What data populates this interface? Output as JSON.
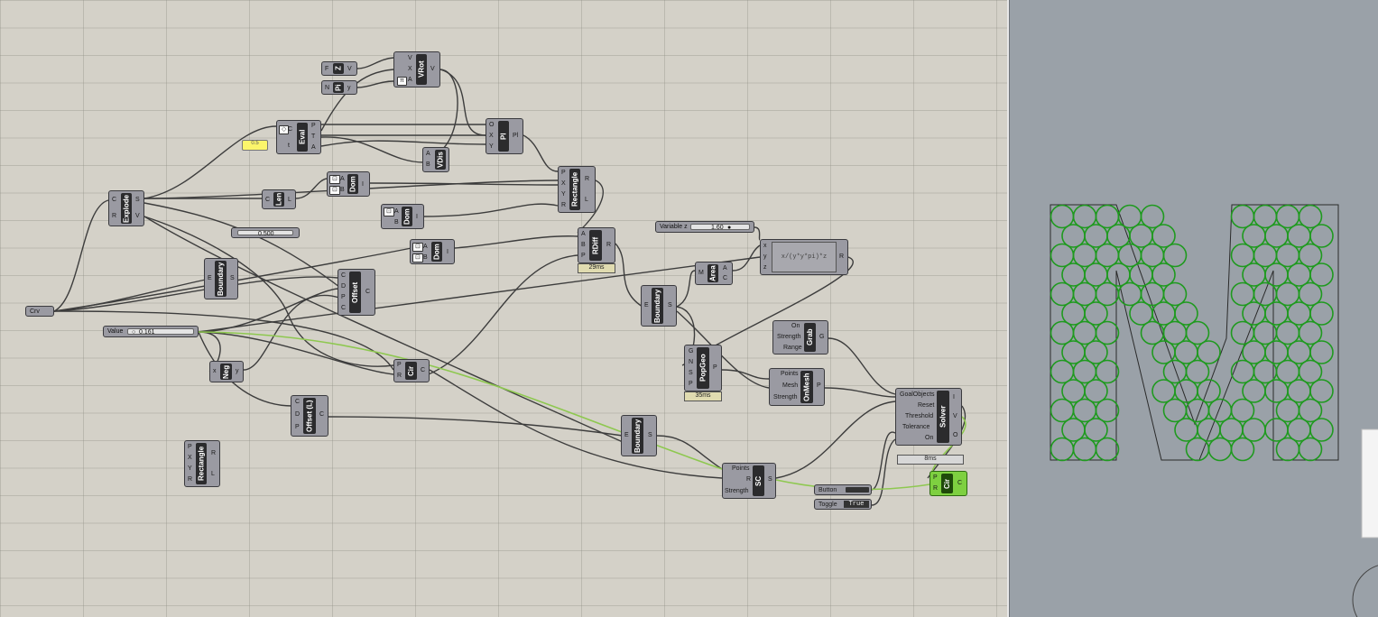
{
  "canvas": {
    "components": {
      "z": {
        "label": "Z",
        "inputs": [
          "F"
        ],
        "outputs": [
          "V"
        ]
      },
      "pi": {
        "label": "Pi",
        "inputs": [
          "N"
        ],
        "outputs": [
          "y"
        ]
      },
      "vrot": {
        "label": "VRot",
        "inputs": [
          "V",
          "X",
          "A"
        ],
        "outputs": [
          "V"
        ]
      },
      "eval": {
        "label": "Eval",
        "inputs": [
          "C",
          "t"
        ],
        "outputs": [
          "P",
          "T",
          "A"
        ]
      },
      "vdis": {
        "label": "VDis",
        "inputs": [
          "A",
          "B"
        ],
        "outputs": []
      },
      "pl": {
        "label": "Pl",
        "inputs": [
          "O",
          "X",
          "Y"
        ],
        "outputs": [
          "Pl"
        ]
      },
      "explode": {
        "label": "Explode",
        "inputs": [
          "C",
          "R"
        ],
        "outputs": [
          "S",
          "V"
        ]
      },
      "len": {
        "label": "Len",
        "inputs": [
          "C"
        ],
        "outputs": [
          "L"
        ]
      },
      "dom1": {
        "label": "Dom",
        "inputs": [
          "A",
          "B"
        ],
        "outputs": [
          "I"
        ]
      },
      "dom2": {
        "label": "Dom",
        "inputs": [
          "A",
          "B"
        ],
        "outputs": [
          "I"
        ]
      },
      "dom3": {
        "label": "Dom",
        "inputs": [
          "A",
          "B"
        ],
        "outputs": [
          "I"
        ]
      },
      "rect1": {
        "label": "Rectangle",
        "inputs": [
          "P",
          "X",
          "Y",
          "R"
        ],
        "outputs": [
          "R",
          "L"
        ]
      },
      "rdiff": {
        "label": "RDiff",
        "inputs": [
          "A",
          "B",
          "P"
        ],
        "outputs": [
          "R"
        ]
      },
      "boundary1": {
        "label": "Boundary",
        "inputs": [
          "E"
        ],
        "outputs": [
          "S"
        ]
      },
      "offset": {
        "label": "Offset",
        "inputs": [
          "C",
          "D",
          "P",
          "C"
        ],
        "outputs": [
          "C"
        ]
      },
      "area": {
        "label": "Area",
        "inputs": [
          "M"
        ],
        "outputs": [
          "A",
          "C"
        ]
      },
      "boundary2": {
        "label": "Boundary",
        "inputs": [
          "E"
        ],
        "outputs": [
          "S"
        ]
      },
      "expr": {
        "label": "x/(y*y*pi)*z",
        "inputs": [
          "x",
          "y",
          "z"
        ],
        "outputs": [
          "R"
        ]
      },
      "grab": {
        "label": "Grab",
        "inputs": [
          "On",
          "Strength",
          "Range"
        ],
        "outputs": [
          "G"
        ]
      },
      "popgeo": {
        "label": "PopGeo",
        "inputs": [
          "G",
          "N",
          "S",
          "P"
        ],
        "outputs": [
          "P"
        ]
      },
      "onmesh": {
        "label": "OnMesh",
        "inputs": [
          "Points",
          "Mesh",
          "Strength"
        ],
        "outputs": [
          "P"
        ]
      },
      "neg": {
        "label": "Neg",
        "inputs": [
          "x"
        ],
        "outputs": [
          "y"
        ]
      },
      "cir1": {
        "label": "Cir",
        "inputs": [
          "P",
          "R"
        ],
        "outputs": [
          "C"
        ]
      },
      "offsetl": {
        "label": "Offset (L)",
        "inputs": [
          "C",
          "D",
          "P"
        ],
        "outputs": [
          "C"
        ]
      },
      "solver": {
        "label": "Solver",
        "inputs": [
          "GoalObjects",
          "Reset",
          "Threshold",
          "Tolerance",
          "On"
        ],
        "outputs": [
          "I",
          "V",
          "O"
        ]
      },
      "boundary3": {
        "label": "Boundary",
        "inputs": [
          "E"
        ],
        "outputs": [
          "S"
        ]
      },
      "rect2": {
        "label": "Rectangle",
        "inputs": [
          "P",
          "X",
          "Y",
          "R"
        ],
        "outputs": [
          "R",
          "L"
        ]
      },
      "sc": {
        "label": "SC",
        "inputs": [
          "Points",
          "R",
          "Strength"
        ],
        "outputs": [
          "S"
        ]
      },
      "cir2": {
        "label": "Cir",
        "inputs": [
          "P",
          "R"
        ],
        "outputs": [
          "C"
        ]
      }
    },
    "params": {
      "crv": "Crv",
      "button": "Button",
      "toggle": "Toggle",
      "toggle_value": "True"
    },
    "sliders": {
      "variable_z": {
        "label": "Variable z",
        "value": "1.60"
      },
      "value": {
        "label": "Value",
        "value": "0.161"
      },
      "half": {
        "value": "0.500"
      }
    },
    "timings": {
      "rdiff": "29ms",
      "popgeo": "35ms",
      "solver": "8ms"
    },
    "panel_yellow": "0.5"
  },
  "colors": {
    "canvas_bg": "#d4d1c8",
    "viewport_bg": "#9aa1a8",
    "component": "#9a9aa2",
    "wire": "#3d3d3d",
    "wire_selected": "#8ec850",
    "selected_component": "#7ed040",
    "circles": "#1f9a1f"
  }
}
